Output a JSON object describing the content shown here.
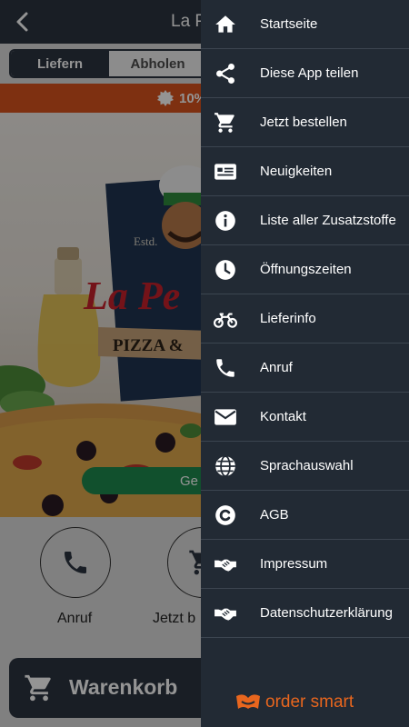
{
  "app": {
    "title": "La P",
    "tabs": {
      "deliver": "Liefern",
      "pickup": "Abholen"
    },
    "promo_text": "10%",
    "hero": {
      "estd": "Estd.",
      "logo_text": "La Pe",
      "banner_text": "PIZZA &"
    },
    "order_button": "Ge",
    "actions": [
      {
        "label": "Anruf",
        "icon": "phone-icon"
      },
      {
        "label": "Jetzt b",
        "icon": "cart-icon"
      }
    ],
    "cart_label": "Warenkorb"
  },
  "menu": {
    "items": [
      {
        "label": "Startseite",
        "icon": "home-icon"
      },
      {
        "label": "Diese App teilen",
        "icon": "share-icon"
      },
      {
        "label": "Jetzt bestellen",
        "icon": "cart-icon"
      },
      {
        "label": "Neuigkeiten",
        "icon": "news-icon"
      },
      {
        "label": "Liste aller Zusatzstoffe",
        "icon": "info-icon"
      },
      {
        "label": "Öffnungszeiten",
        "icon": "clock-icon"
      },
      {
        "label": "Lieferinfo",
        "icon": "motorcycle-icon"
      },
      {
        "label": "Anruf",
        "icon": "phone-icon"
      },
      {
        "label": "Kontakt",
        "icon": "envelope-icon"
      },
      {
        "label": "Sprachauswahl",
        "icon": "globe-icon"
      },
      {
        "label": "AGB",
        "icon": "copyright-icon"
      },
      {
        "label": "Impressum",
        "icon": "handshake-icon"
      },
      {
        "label": "Datenschutzerklärung",
        "icon": "handshake-icon"
      }
    ],
    "brand": "order smart"
  },
  "colors": {
    "header": "#2b3440",
    "menu_bg": "#222a34",
    "promo": "#d9541e",
    "order_button": "#1e8a4e",
    "brand": "#e8661e"
  }
}
